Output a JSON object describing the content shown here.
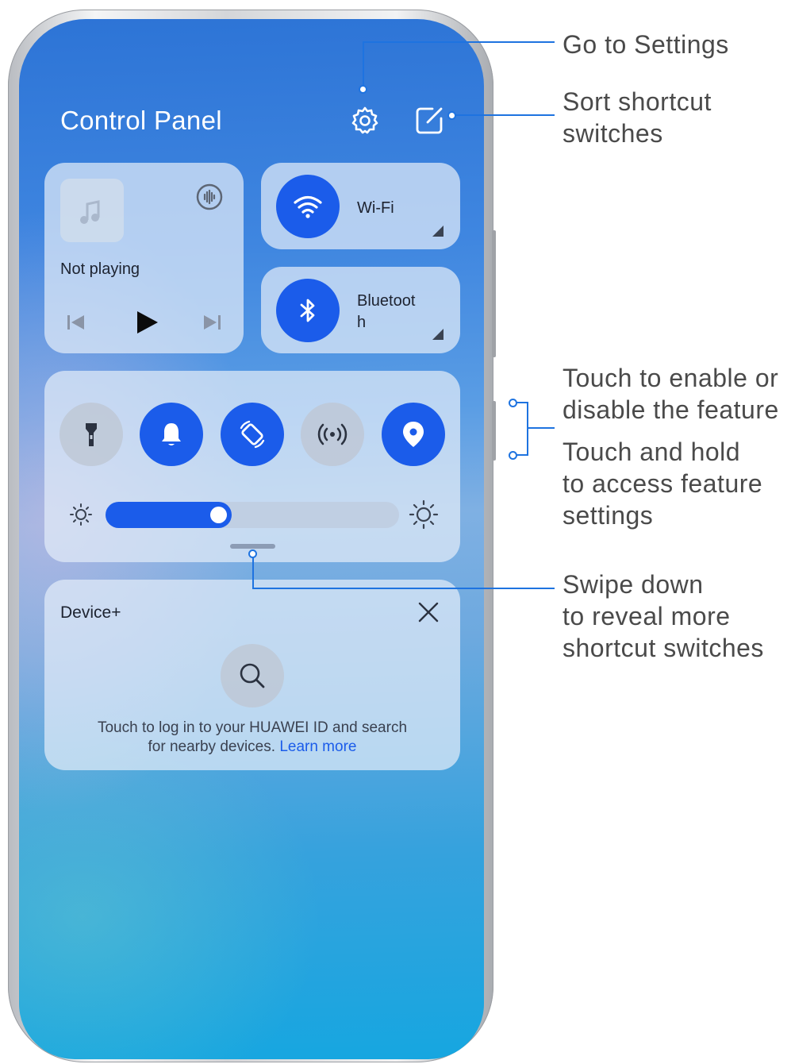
{
  "panel": {
    "title": "Control Panel",
    "icons": {
      "settings": "gear-icon",
      "sort": "edit-square-icon"
    }
  },
  "media": {
    "status": "Not playing",
    "icons": [
      "music-note-icon",
      "audio-output-icon",
      "previous-icon",
      "play-icon",
      "next-icon"
    ]
  },
  "toggles": {
    "wifi": {
      "label": "Wi-Fi",
      "icon": "wifi-icon",
      "on": true
    },
    "bluetooth": {
      "label_line1": "Bluetoot",
      "label_line2": "h",
      "icon": "bluetooth-icon",
      "on": true
    }
  },
  "shortcuts": [
    {
      "name": "flashlight",
      "icon": "flashlight-icon",
      "on": false
    },
    {
      "name": "sound",
      "icon": "bell-icon",
      "on": true
    },
    {
      "name": "auto-rotate",
      "icon": "rotate-icon",
      "on": true
    },
    {
      "name": "nfc",
      "icon": "broadcast-icon",
      "on": false
    },
    {
      "name": "location",
      "icon": "location-pin-icon",
      "on": true
    }
  ],
  "brightness": {
    "level_percent": 43,
    "icons": [
      "sun-small-icon",
      "sun-large-icon"
    ]
  },
  "device_plus": {
    "title": "Device+",
    "message_line1": "Touch to log in to your HUAWEI ID and search",
    "message_line2": "for nearby devices.",
    "link": "Learn more",
    "icons": [
      "close-icon",
      "search-icon"
    ]
  },
  "callouts": {
    "settings": "Go to Settings",
    "sort_line1": "Sort shortcut",
    "sort_line2": "switches",
    "enable_line1": "Touch to enable or",
    "enable_line2": "disable the feature",
    "hold_line1": "Touch and hold",
    "hold_line2": "to access feature",
    "hold_line3": "settings",
    "swipe_line1": "Swipe down",
    "swipe_line2": "to reveal more",
    "swipe_line3": "shortcut switches"
  },
  "colors": {
    "accent": "#1b5cea",
    "leader": "#1e73e0",
    "callout_text": "#4a4a4a"
  }
}
